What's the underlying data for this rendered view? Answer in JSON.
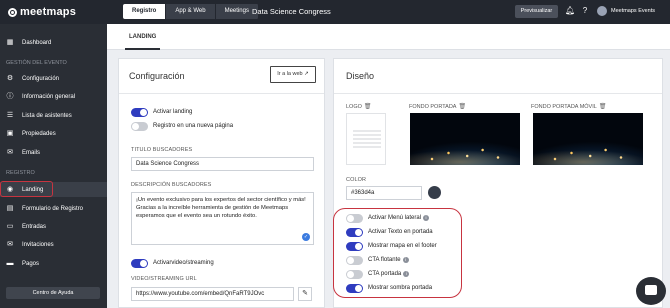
{
  "brand": {
    "name": "meetmaps"
  },
  "topbar": {
    "tabs": [
      "Registro",
      "App & Web",
      "Meetings"
    ],
    "active_tab": 0,
    "event_title": "Data Science Congress",
    "preview_label": "Previsualizar",
    "organization": "Meetmaps Events"
  },
  "sidebar": {
    "dashboard": "Dashboard",
    "section_event": "GESTIÓN DEL EVENTO",
    "event_items": [
      "Configuración",
      "Información general",
      "Lista de asistentes",
      "Propiedades",
      "Emails"
    ],
    "section_registro": "REGISTRO",
    "registro_items": [
      "Landing",
      "Formulario de Registro",
      "Entradas",
      "Invitaciones",
      "Pagos"
    ],
    "help_label": "Centro de Ayuda"
  },
  "subnav": {
    "tab": "LANDING"
  },
  "config": {
    "title": "Configuración",
    "web_button": "Ir a la web",
    "toggle_landing": "Activar landing",
    "toggle_new_page": "Registro en una nueva página",
    "seo_title_label": "TITULO BUSCADORES",
    "seo_title_value": "Data Science Congress",
    "seo_desc_label": "DESCRIPCIÓN BUSCADORES",
    "seo_desc_value": "¡Un evento exclusivo para los expertos del sector científico y más! Gracias a la increíble herramienta de gestión de Meetmaps esperamos que el evento sea un rotundo éxito.",
    "toggle_video": "Activarvideo/streaming",
    "video_label": "VIDEO/STREAMING URL",
    "video_value": "https://www.youtube.com/embed/QnFaRT9JOvc"
  },
  "design": {
    "title": "Diseño",
    "logo_label": "LOGO",
    "cover_label": "FONDO PORTADA",
    "cover_mobile_label": "FONDO PORTADA MÓVIL",
    "color_label": "COLOR",
    "color_value": "#363d4a",
    "options": [
      {
        "label": "Activar Menú lateral",
        "on": false,
        "info": true
      },
      {
        "label": "Activar Texto en portada",
        "on": true,
        "info": false
      },
      {
        "label": "Mostrar mapa en el footer",
        "on": true,
        "info": false
      },
      {
        "label": "CTA flotante",
        "on": false,
        "info": true
      },
      {
        "label": "CTA portada",
        "on": false,
        "info": true
      },
      {
        "label": "Mostrar sombra portada",
        "on": true,
        "info": false
      }
    ]
  },
  "colors": {
    "accent": "#2f3cbf",
    "highlight": "#c73440",
    "sidebar": "#2a2e35"
  }
}
